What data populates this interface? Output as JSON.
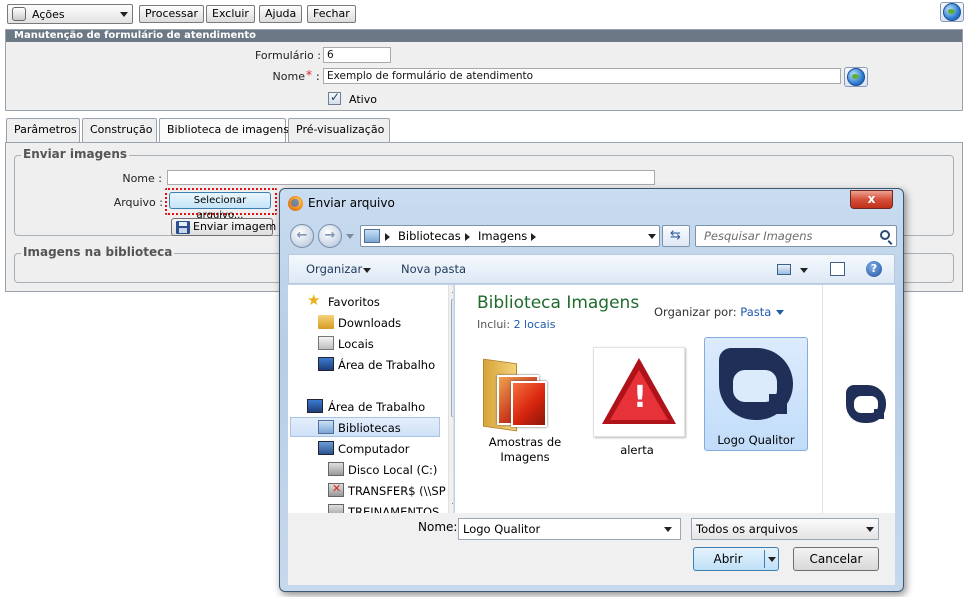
{
  "toolbar": {
    "acoes_label": "Ações",
    "processar_label": "Processar",
    "excluir_label": "Excluir",
    "ajuda_label": "Ajuda",
    "fechar_label": "Fechar"
  },
  "form": {
    "header": "Manutenção de formulário de atendimento",
    "formulario_label": "Formulário :",
    "formulario_value": "6",
    "nome_label": "Nome",
    "nome_required": "*",
    "nome_colon": ":",
    "nome_value": "Exemplo de formulário de atendimento",
    "ativo_label": "Ativo",
    "ativo_checked": true
  },
  "tabs": [
    {
      "label": "Parâmetros"
    },
    {
      "label": "Construção"
    },
    {
      "label": "Biblioteca de imagens"
    },
    {
      "label": "Pré-visualização"
    }
  ],
  "enviar": {
    "legend": "Enviar imagens",
    "nome_label": "Nome :",
    "arquivo_label": "Arquivo :",
    "selecionar_label": "Selecionar arquivo...",
    "enviar_label": "Enviar imagem"
  },
  "biblioteca": {
    "legend": "Imagens na biblioteca"
  },
  "dialog": {
    "title": "Enviar arquivo",
    "close_glyph": "x",
    "breadcrumb": [
      "Bibliotecas",
      "Imagens"
    ],
    "search_placeholder": "Pesquisar Imagens",
    "organizar_label": "Organizar",
    "nova_pasta_label": "Nova pasta",
    "nav_items": [
      {
        "label": "Favoritos"
      },
      {
        "label": "Downloads"
      },
      {
        "label": "Locais"
      },
      {
        "label": "Área de Trabalho"
      },
      {
        "label": "Área de Trabalho"
      },
      {
        "label": "Bibliotecas"
      },
      {
        "label": "Computador"
      },
      {
        "label": "Disco Local (C:)"
      },
      {
        "label": "TRANSFER$ (\\\\SP"
      },
      {
        "label": "TREINAMENTOS"
      }
    ],
    "library_title": "Biblioteca Imagens",
    "includes_label": "Inclui:",
    "includes_link": "2 locais",
    "organize_by_label": "Organizar por:",
    "organize_by_value": "Pasta",
    "files": [
      {
        "label": "Amostras de Imagens"
      },
      {
        "label": "alerta"
      },
      {
        "label": "Logo Qualitor"
      }
    ],
    "filename_label": "Nome:",
    "filename_value": "Logo Qualitor",
    "filetype_value": "Todos os arquivos",
    "open_label": "Abrir",
    "cancel_label": "Cancelar"
  }
}
